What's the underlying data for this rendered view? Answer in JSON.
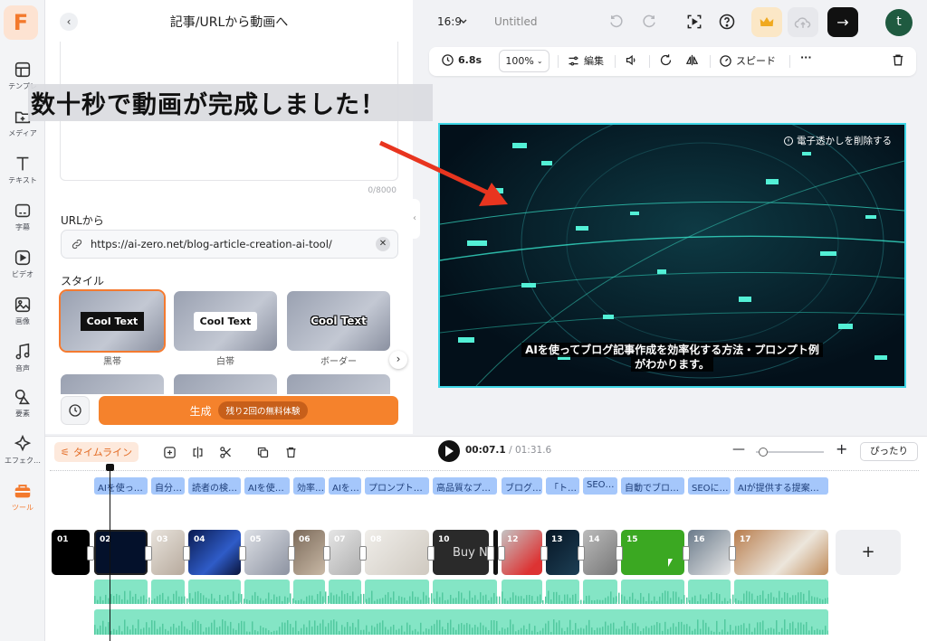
{
  "app": {
    "logo": "F"
  },
  "rail": {
    "items": [
      {
        "label": "テンプレ",
        "icon": "template-icon"
      },
      {
        "label": "メディア",
        "icon": "media-add-icon"
      },
      {
        "label": "テキスト",
        "icon": "text-icon"
      },
      {
        "label": "字幕",
        "icon": "subtitle-icon"
      },
      {
        "label": "ビデオ",
        "icon": "video-icon"
      },
      {
        "label": "画像",
        "icon": "image-icon"
      },
      {
        "label": "音声",
        "icon": "music-icon"
      },
      {
        "label": "要素",
        "icon": "shapes-icon"
      },
      {
        "label": "エフェク…",
        "icon": "effects-icon"
      },
      {
        "label": "ツール",
        "icon": "toolbox-icon"
      }
    ]
  },
  "panel": {
    "title": "記事/URLから動画へ",
    "counter": "0/8000",
    "url_label": "URLから",
    "url_value": "https://ai-zero.net/blog-article-creation-ai-tool/",
    "style_label": "スタイル",
    "styles": [
      {
        "chip": "Cool Text",
        "label": "黒帯"
      },
      {
        "chip": "Cool Text",
        "label": "白帯"
      },
      {
        "chip": "Cool Text",
        "label": "ボーダー"
      }
    ],
    "generate_label": "生成",
    "generate_badge": "残り2回の無料体験"
  },
  "overlay_caption": "数十秒で動画が完成しました！",
  "topbar": {
    "aspect": "16:9",
    "project_name": "Untitled",
    "avatar_letter": "t"
  },
  "toolbar": {
    "duration": "6.8s",
    "zoom": "100%",
    "edit": "編集",
    "speed": "スピード"
  },
  "video": {
    "watermark": "電子透かしを削除する",
    "subtitle_line1": "AIを使ってブログ記事作成を効率化する方法・プロンプト例",
    "subtitle_line2": "がわかります。"
  },
  "timeline": {
    "tab": "タイムライン",
    "current_time": "00:07.1",
    "total_time": "/ 01:31.6",
    "fit": "ぴったり",
    "text_segments": [
      "AIを使っ…",
      "自分…",
      "読者の検…",
      "AIを使…",
      "効率…",
      "AIを…",
      "プロンプト…",
      "高品質なプ…",
      "ブログ…",
      "「ト…",
      "SEO…",
      "自動でブロ…",
      "SEOに…",
      "AIが提供する提案…"
    ],
    "clips": [
      "01",
      "02",
      "03",
      "04",
      "05",
      "06",
      "07",
      "08",
      "10",
      "12",
      "13",
      "14",
      "15",
      "16",
      "17"
    ],
    "clip10_text": "Buy N"
  }
}
